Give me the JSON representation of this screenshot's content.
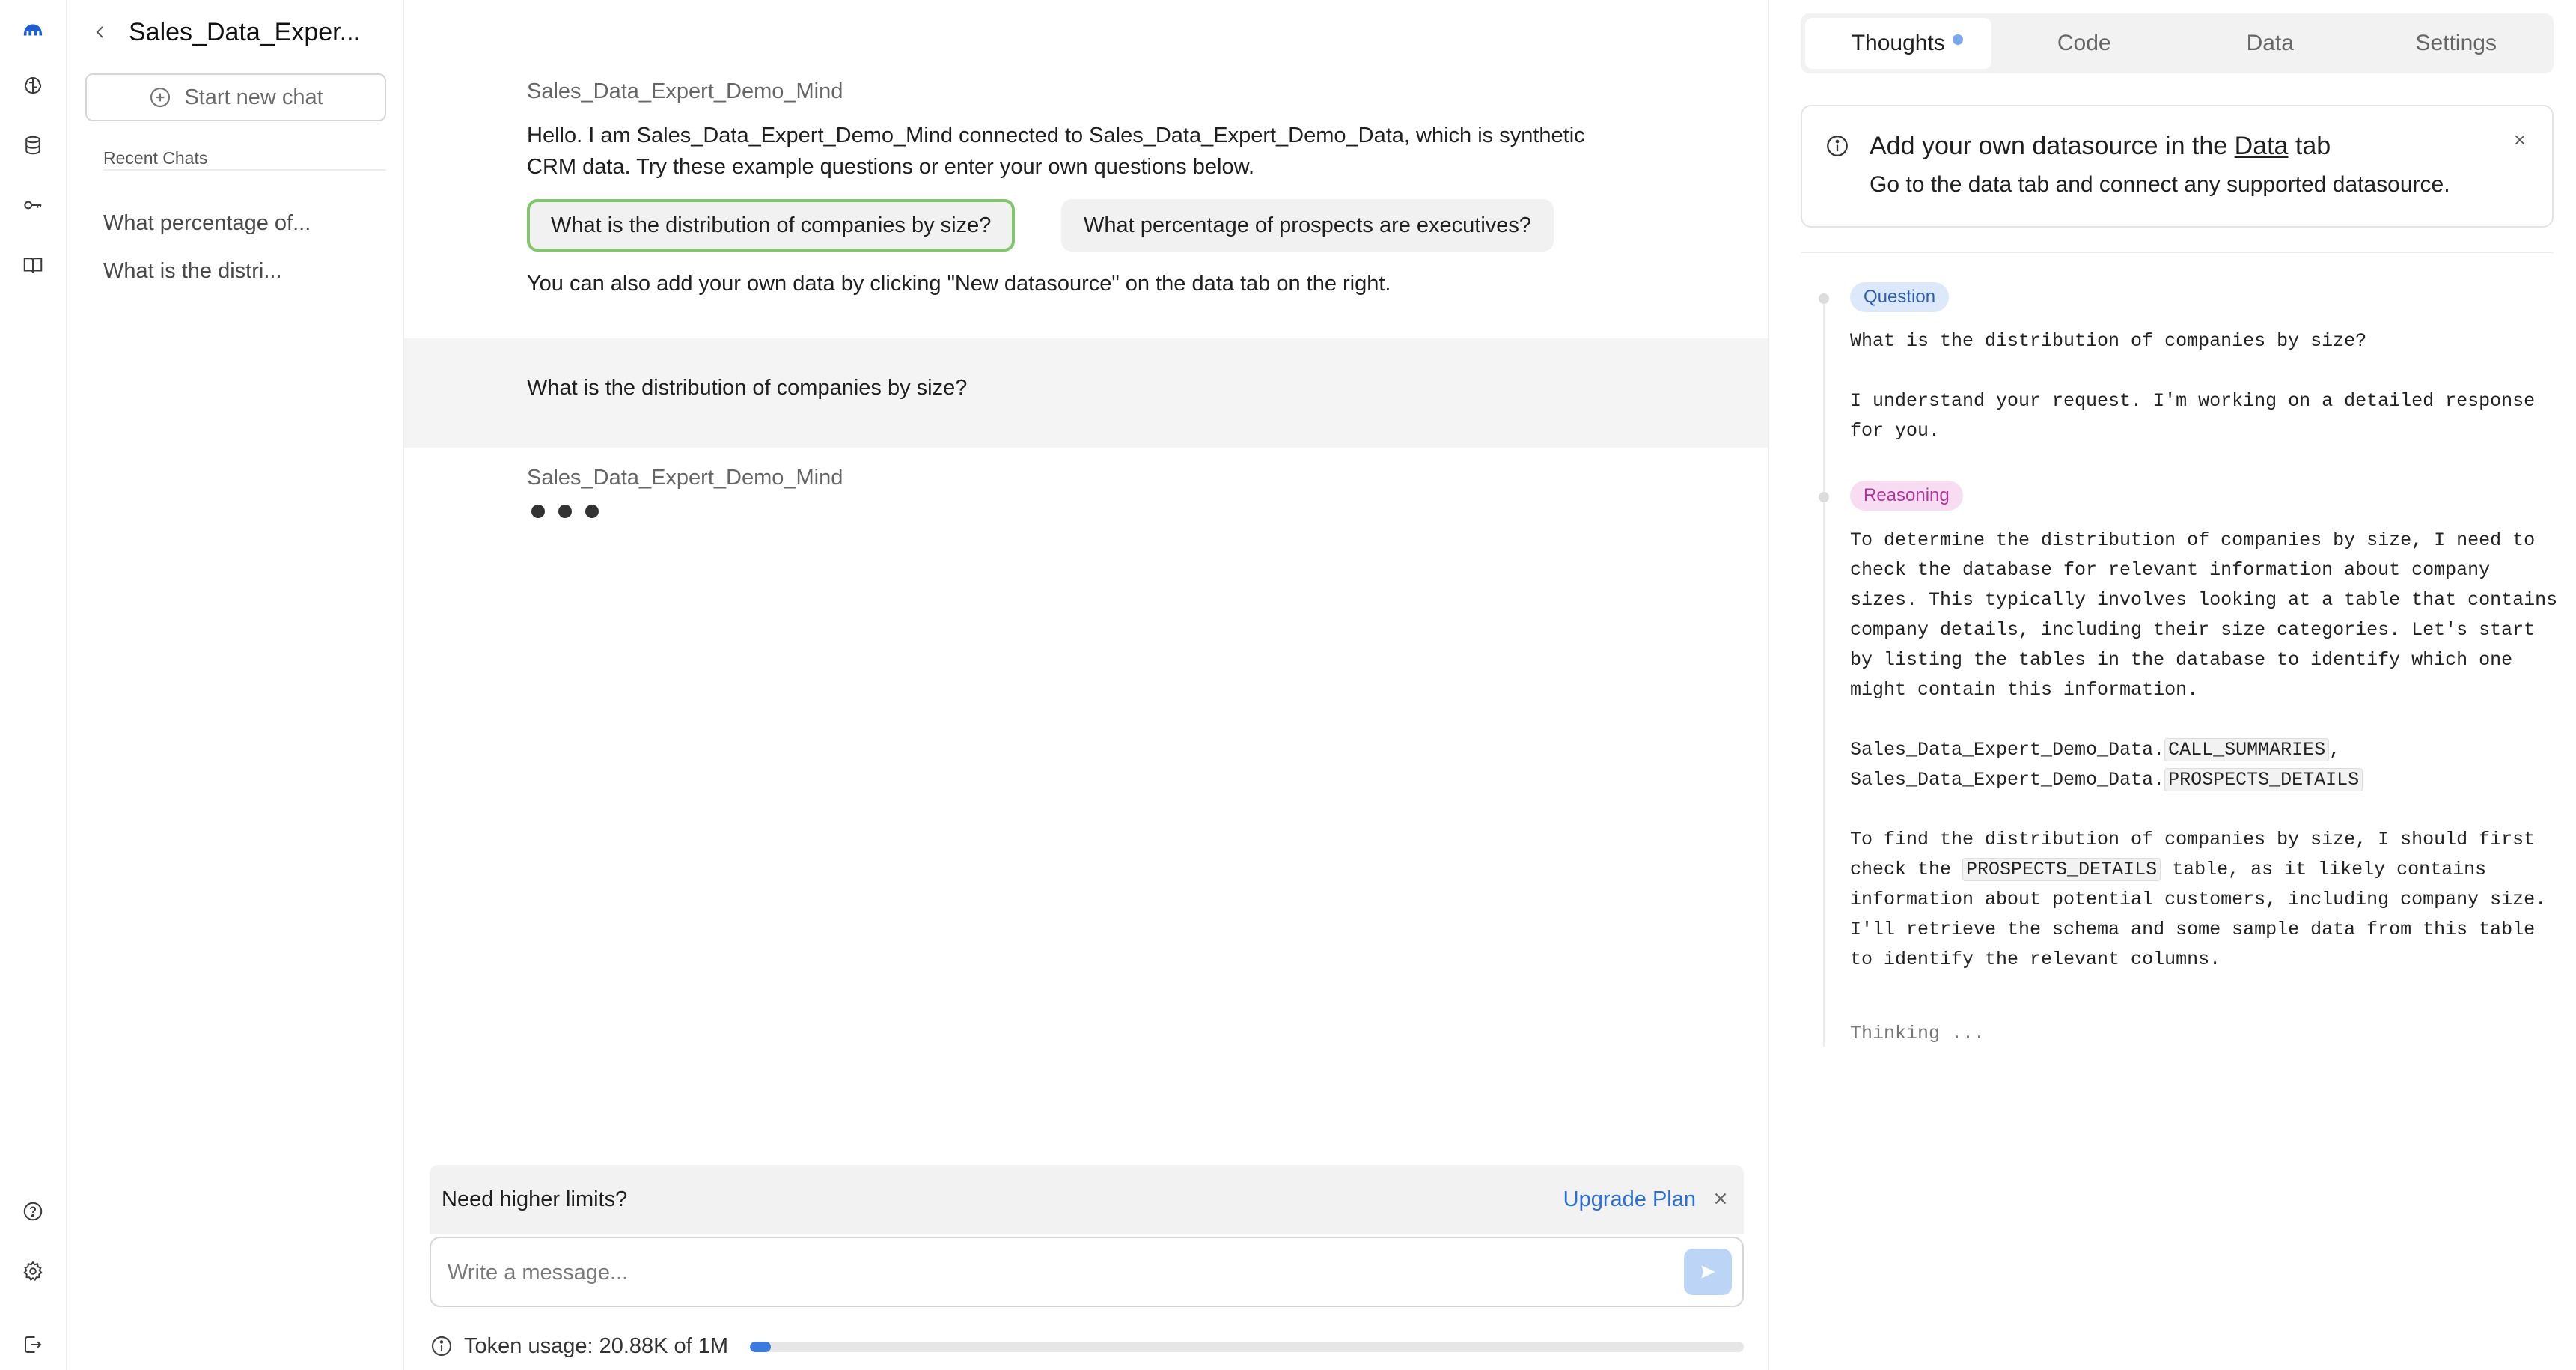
{
  "rail": {
    "icons": [
      "logo-icon",
      "brain-icon",
      "database-icon",
      "key-icon",
      "book-icon",
      "help-icon",
      "settings-icon",
      "logout-icon"
    ]
  },
  "history": {
    "title": "Sales_Data_Exper...",
    "new_chat_label": "Start new chat",
    "recent_label": "Recent Chats",
    "items": [
      {
        "label": "What percentage of..."
      },
      {
        "label": "What is the distri..."
      }
    ]
  },
  "chat": {
    "bot_name": "Sales_Data_Expert_Demo_Mind",
    "greeting": "Hello. I am Sales_Data_Expert_Demo_Mind connected to Sales_Data_Expert_Demo_Data, which is synthetic CRM data. Try these example questions or enter your own questions below.",
    "suggestions": [
      {
        "label": "What is the distribution of companies by size?",
        "active": true
      },
      {
        "label": "What percentage of prospects are executives?",
        "active": false
      }
    ],
    "hint": "You can also add your own data by clicking \"New datasource\" on the data tab on the right.",
    "user_message": "What is the distribution of companies by size?",
    "reply_bot_name": "Sales_Data_Expert_Demo_Mind",
    "limits_text": "Need higher limits?",
    "upgrade_label": "Upgrade Plan",
    "input_placeholder": "Write a message...",
    "token_usage_text": "Token usage: 20.88K of 1M",
    "token_usage_fraction": 0.02088
  },
  "right_panel": {
    "tabs": [
      {
        "label": "Thoughts",
        "active": true
      },
      {
        "label": "Code",
        "active": false
      },
      {
        "label": "Data",
        "active": false
      },
      {
        "label": "Settings",
        "active": false
      }
    ],
    "datasource_card": {
      "title_prefix": "Add your own datasource in the ",
      "title_link": "Data",
      "title_suffix": " tab",
      "subtitle": "Go to the data tab and connect any supported datasource."
    },
    "question_badge": "Question",
    "question_text": "What is the distribution of companies by size?",
    "ack_text": "I understand your request. I'm working on a detailed response for you.",
    "reasoning_badge": "Reasoning",
    "reasoning_1": "To determine the distribution of companies by size, I need to check the database for relevant information about company sizes. This typically involves looking at a table that contains company details, including their size categories. Let's start by listing the tables in the database to identify which one might contain this information.",
    "table_prefix": "Sales_Data_Expert_Demo_Data.",
    "table_1": "CALL_SUMMARIES",
    "table_2": "PROSPECTS_DETAILS",
    "reasoning_2_part1": "To find the distribution of companies by size, I should first check the ",
    "reasoning_2_code": "PROSPECTS_DETAILS",
    "reasoning_2_part2": " table, as it likely contains information about potential customers, including company size. I'll retrieve the schema and some sample data from this table to identify the relevant columns.",
    "thinking_text": "Thinking ..."
  },
  "colors": {
    "accent_blue": "#2b6fd6",
    "active_chip_border": "#7fc76a",
    "question_badge_bg": "#dce9fb",
    "reasoning_badge_bg": "#f8dcf2"
  }
}
